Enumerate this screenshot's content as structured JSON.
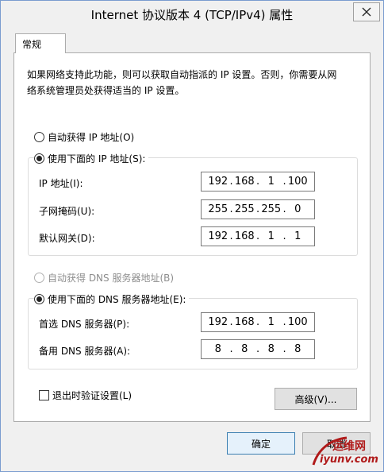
{
  "window": {
    "title": "Internet 协议版本 4 (TCP/IPv4) 属性"
  },
  "tab": {
    "label": "常规"
  },
  "description": {
    "line1": "如果网络支持此功能，则可以获取自动指派的 IP 设置。否则，你需要从网",
    "line2": "络系统管理员处获得适当的 IP 设置。"
  },
  "ip": {
    "auto_label": "自动获得 IP 地址(O)",
    "manual_label": "使用下面的 IP 地址(S):",
    "address_label": "IP 地址(I):",
    "address": [
      "192",
      "168",
      "1",
      "100"
    ],
    "subnet_label": "子网掩码(U):",
    "subnet": [
      "255",
      "255",
      "255",
      "0"
    ],
    "gateway_label": "默认网关(D):",
    "gateway": [
      "192",
      "168",
      "1",
      "1"
    ]
  },
  "dns": {
    "auto_label": "自动获得 DNS 服务器地址(B)",
    "manual_label": "使用下面的 DNS 服务器地址(E):",
    "preferred_label": "首选 DNS 服务器(P):",
    "preferred": [
      "192",
      "168",
      "1",
      "100"
    ],
    "alternate_label": "备用 DNS 服务器(A):",
    "alternate": [
      "8",
      "8",
      "8",
      "8"
    ]
  },
  "validate_label": "退出时验证设置(L)",
  "advanced_label": "高级(V)...",
  "ok_label": "确定",
  "cancel_label": "取消",
  "watermark": {
    "line1": "运维网",
    "line2": "iyunv.com"
  }
}
